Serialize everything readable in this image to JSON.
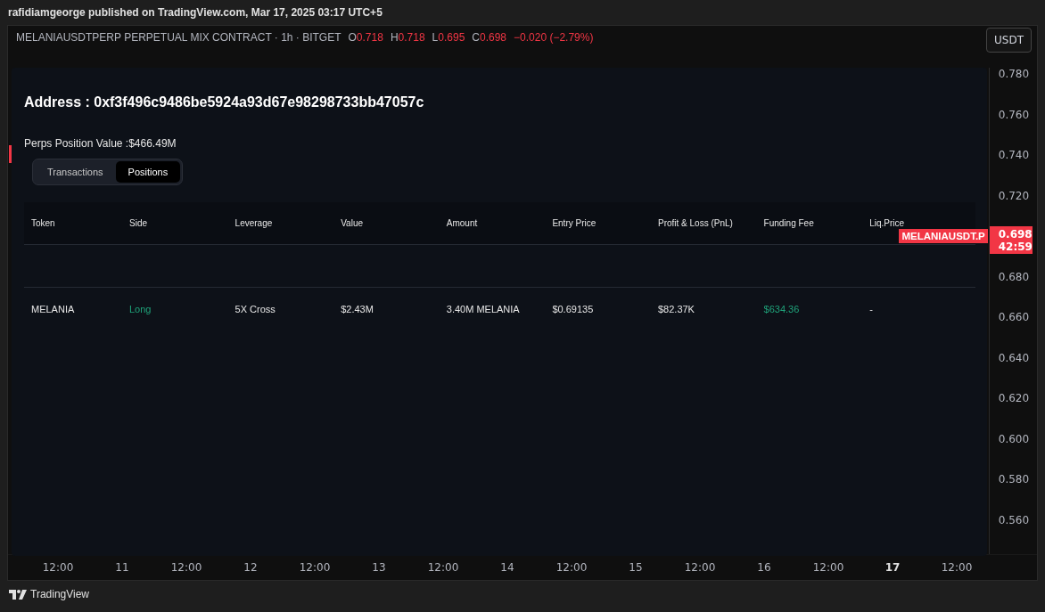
{
  "header": {
    "publisher": "rafidiamgeorge published on TradingView.com, Mar 17, 2025 03:17 UTC+5"
  },
  "legend": {
    "symbol": "MELANIAUSDTPERP PERPETUAL MIX CONTRACT · 1h · BITGET",
    "ohlc": [
      {
        "key": "O",
        "value": "0.718"
      },
      {
        "key": "H",
        "value": "0.718"
      },
      {
        "key": "L",
        "value": "0.695"
      },
      {
        "key": "C",
        "value": "0.698"
      }
    ],
    "change": "−0.020 (−2.79%)"
  },
  "currency_button": "USDT",
  "panel": {
    "address": "Address : 0xf3f496c9486be5924a93d67e98298733bb47057c",
    "position_value": "Perps Position Value :$466.49M",
    "tabs": [
      {
        "label": "Transactions",
        "selected": false
      },
      {
        "label": "Positions",
        "selected": true
      }
    ],
    "table": {
      "columns": [
        "Token",
        "Side",
        "Leverage",
        "Value",
        "Amount",
        "Entry Price",
        "Profit & Loss (PnL)",
        "Funding Fee",
        "Liq.Price"
      ],
      "rows": [
        {
          "cells": [
            {
              "text": "MELANIA",
              "kind": "plain"
            },
            {
              "text": "Long",
              "kind": "positive"
            },
            {
              "text": "5X Cross",
              "kind": "plain"
            },
            {
              "text": "$2.43M",
              "kind": "plain"
            },
            {
              "text": "3.40M MELANIA",
              "kind": "plain"
            },
            {
              "text": "$0.69135",
              "kind": "plain"
            },
            {
              "text": "$82.37K",
              "kind": "plain"
            },
            {
              "text": "$634.36",
              "kind": "positive"
            },
            {
              "text": "-",
              "kind": "plain"
            }
          ]
        }
      ]
    }
  },
  "price_axis": [
    {
      "kind": "tick",
      "text": "0.780"
    },
    {
      "kind": "tick",
      "text": "0.760"
    },
    {
      "kind": "tick",
      "text": "0.740"
    },
    {
      "kind": "tick",
      "text": "0.720"
    },
    {
      "kind": "current",
      "symbol": "MELANIAUSDT.P",
      "price": "0.698",
      "countdown": "42:59"
    },
    {
      "kind": "tick",
      "text": "0.680"
    },
    {
      "kind": "tick",
      "text": "0.660"
    },
    {
      "kind": "tick",
      "text": "0.640"
    },
    {
      "kind": "tick",
      "text": "0.620"
    },
    {
      "kind": "tick",
      "text": "0.600"
    },
    {
      "kind": "tick",
      "text": "0.580"
    },
    {
      "kind": "tick",
      "text": "0.560"
    }
  ],
  "time_axis": [
    {
      "text": "12:00",
      "bold": false
    },
    {
      "text": "11",
      "bold": false
    },
    {
      "text": "12:00",
      "bold": false
    },
    {
      "text": "12",
      "bold": false
    },
    {
      "text": "12:00",
      "bold": false
    },
    {
      "text": "13",
      "bold": false
    },
    {
      "text": "12:00",
      "bold": false
    },
    {
      "text": "14",
      "bold": false
    },
    {
      "text": "12:00",
      "bold": false
    },
    {
      "text": "15",
      "bold": false
    },
    {
      "text": "12:00",
      "bold": false
    },
    {
      "text": "16",
      "bold": false
    },
    {
      "text": "12:00",
      "bold": false
    },
    {
      "text": "17",
      "bold": true
    },
    {
      "text": "12:00",
      "bold": false
    }
  ],
  "footer": {
    "brand": "TradingView"
  }
}
